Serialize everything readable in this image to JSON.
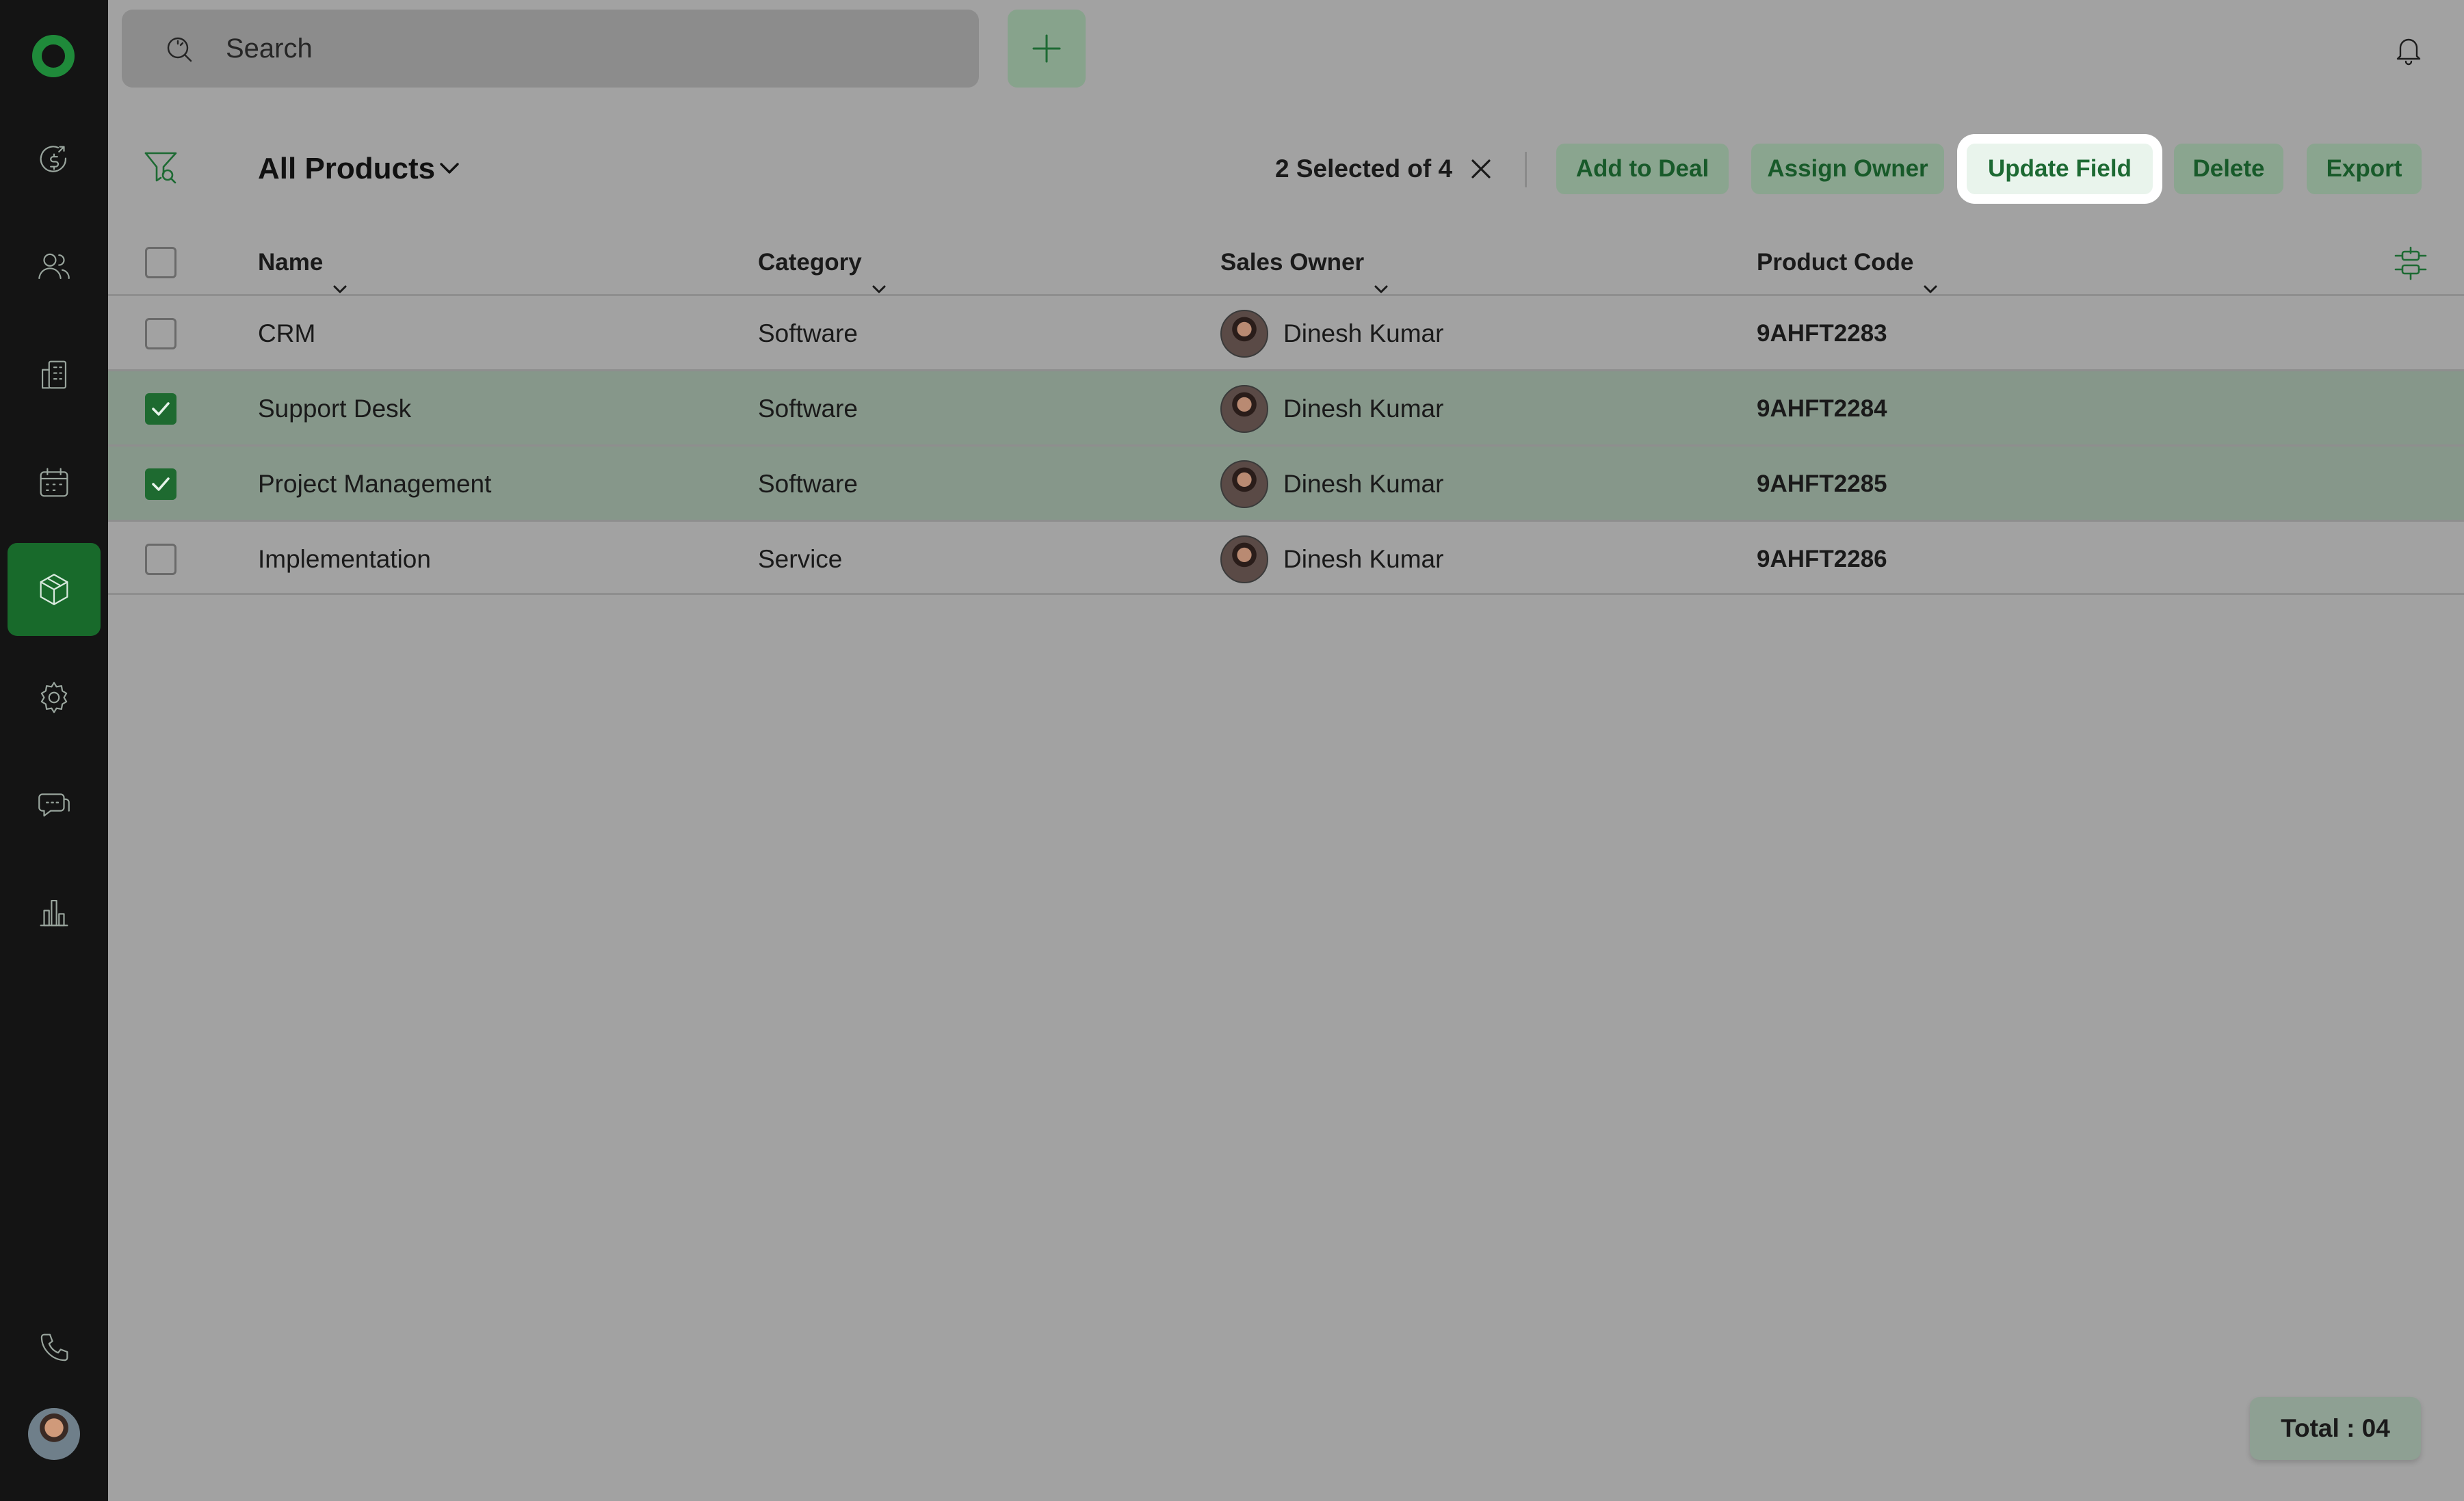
{
  "search": {
    "placeholder": "Search"
  },
  "sidebar": {
    "items": [
      {
        "icon": "deals-icon"
      },
      {
        "icon": "contacts-icon"
      },
      {
        "icon": "accounts-icon"
      },
      {
        "icon": "calendar-icon"
      },
      {
        "icon": "products-icon",
        "active": true
      },
      {
        "icon": "settings-icon"
      },
      {
        "icon": "chat-icon"
      },
      {
        "icon": "reports-icon"
      }
    ],
    "bottom": [
      {
        "icon": "phone-icon"
      },
      {
        "icon": "user-avatar"
      }
    ]
  },
  "toolbar": {
    "view_title": "All Products",
    "selection_text": "2 Selected of 4",
    "actions": {
      "add_to_deal": "Add to Deal",
      "assign_owner": "Assign Owner",
      "update_field": "Update Field",
      "delete": "Delete",
      "export": "Export"
    }
  },
  "table": {
    "columns": {
      "name": "Name",
      "category": "Category",
      "sales_owner": "Sales Owner",
      "product_code": "Product Code"
    },
    "rows": [
      {
        "name": "CRM",
        "category": "Software",
        "owner": "Dinesh Kumar",
        "code": "9AHFT2283",
        "checked": false
      },
      {
        "name": "Support Desk",
        "category": "Software",
        "owner": "Dinesh Kumar",
        "code": "9AHFT2284",
        "checked": true
      },
      {
        "name": "Project Management",
        "category": "Software",
        "owner": "Dinesh Kumar",
        "code": "9AHFT2285",
        "checked": true
      },
      {
        "name": "Implementation",
        "category": "Service",
        "owner": "Dinesh Kumar",
        "code": "9AHFT2286",
        "checked": false
      }
    ]
  },
  "footer": {
    "total": "Total : 04"
  },
  "colors": {
    "brand": "#1d6a33",
    "sidebar_bg": "#141414",
    "overlay_bg": "#a2a2a2",
    "highlight": "#ffffff"
  }
}
